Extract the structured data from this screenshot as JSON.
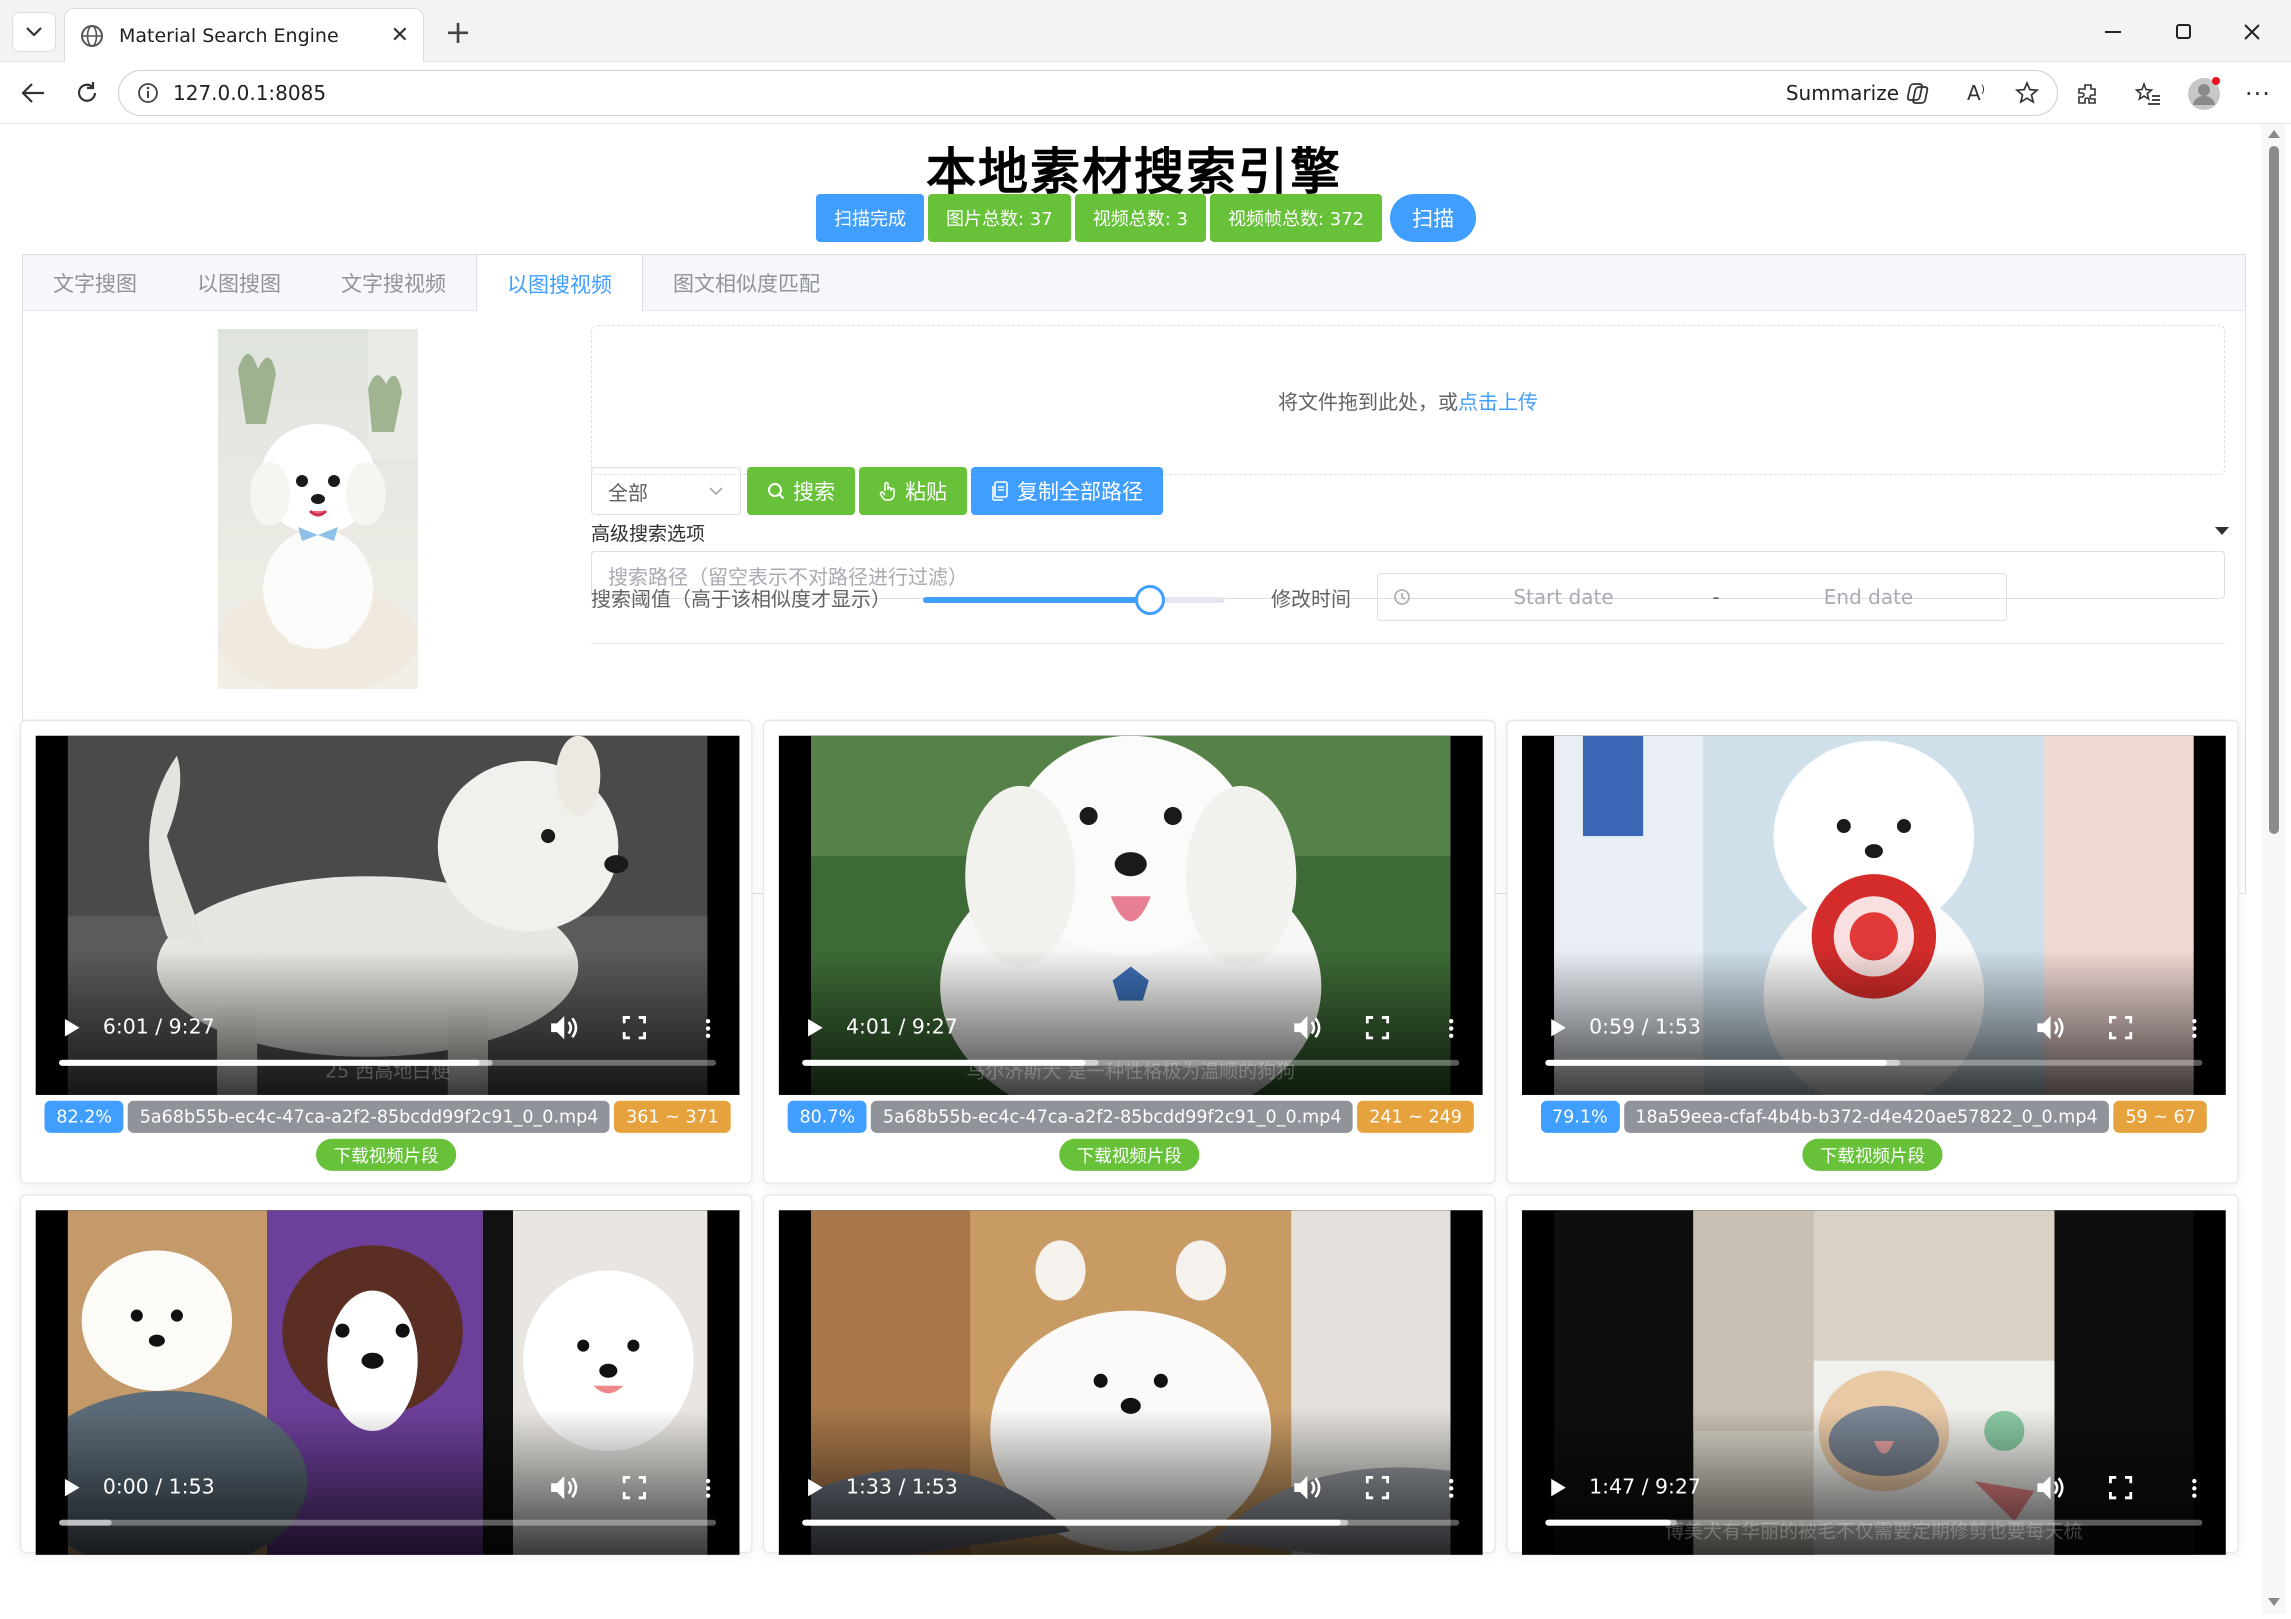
{
  "browser": {
    "tab_title": "Material Search Engine",
    "url": "127.0.0.1:8085",
    "summarize_label": "Summarize"
  },
  "app": {
    "title": "本地素材搜索引擎",
    "status": "扫描完成",
    "image_total": "图片总数: 37",
    "video_total": "视频总数: 3",
    "frame_total": "视频帧总数: 372",
    "scan_button": "扫描"
  },
  "tabs": [
    {
      "label": "文字搜图",
      "active": false
    },
    {
      "label": "以图搜图",
      "active": false
    },
    {
      "label": "文字搜视频",
      "active": false
    },
    {
      "label": "以图搜视频",
      "active": true
    },
    {
      "label": "图文相似度匹配",
      "active": false
    }
  ],
  "upload": {
    "text": "将文件拖到此处，或",
    "link": "点击上传"
  },
  "controls": {
    "select_value": "全部",
    "search": "搜索",
    "paste": "粘贴",
    "copy_all": "复制全部路径"
  },
  "advanced": {
    "title": "高级搜索选项",
    "path_placeholder": "搜索路径（留空表示不对路径进行过滤）",
    "threshold_label": "搜索阈值（高于该相似度才显示）",
    "threshold_value": 0.75,
    "mtime_label": "修改时间",
    "start_placeholder": "Start date",
    "end_placeholder": "End date",
    "range_sep": "-"
  },
  "results": [
    {
      "time": "6:01 / 9:27",
      "played": 0.64,
      "buffered": 0.66,
      "subtitle": "25 西高地白梗",
      "score": "82.2%",
      "file": "5a68b55b-ec4c-47ca-a2f2-85bcdd99f2c91_0_0.mp4",
      "range": "361 ~ 371",
      "download": "下载视频片段"
    },
    {
      "time": "4:01 / 9:27",
      "played": 0.43,
      "buffered": 0.45,
      "subtitle": "马尔济斯犬 是一种性格极为温顺的狗狗",
      "score": "80.7%",
      "file": "5a68b55b-ec4c-47ca-a2f2-85bcdd99f2c91_0_0.mp4",
      "range": "241 ~ 249",
      "download": "下载视频片段"
    },
    {
      "time": "0:59 / 1:53",
      "played": 0.52,
      "buffered": 0.54,
      "subtitle": "",
      "score": "79.1%",
      "file": "18a59eea-cfaf-4b4b-b372-d4e420ae57822_0_0.mp4",
      "range": "59 ~ 67",
      "download": "下载视频片段"
    },
    {
      "time": "0:00 / 1:53",
      "played": 0.0,
      "buffered": 0.08,
      "subtitle": "",
      "score": "",
      "file": "",
      "range": "",
      "download": ""
    },
    {
      "time": "1:33 / 1:53",
      "played": 0.82,
      "buffered": 0.83,
      "subtitle": "",
      "score": "",
      "file": "",
      "range": "",
      "download": ""
    },
    {
      "time": "1:47 / 9:27",
      "played": 0.19,
      "buffered": 0.2,
      "subtitle": "博美犬有华丽的被毛不仅需要定期修剪也要每天梳",
      "score": "",
      "file": "",
      "range": "",
      "download": ""
    }
  ],
  "colors": {
    "primary": "#409eff",
    "success": "#67c23a",
    "info": "#909399",
    "warning": "#e6a23c"
  }
}
